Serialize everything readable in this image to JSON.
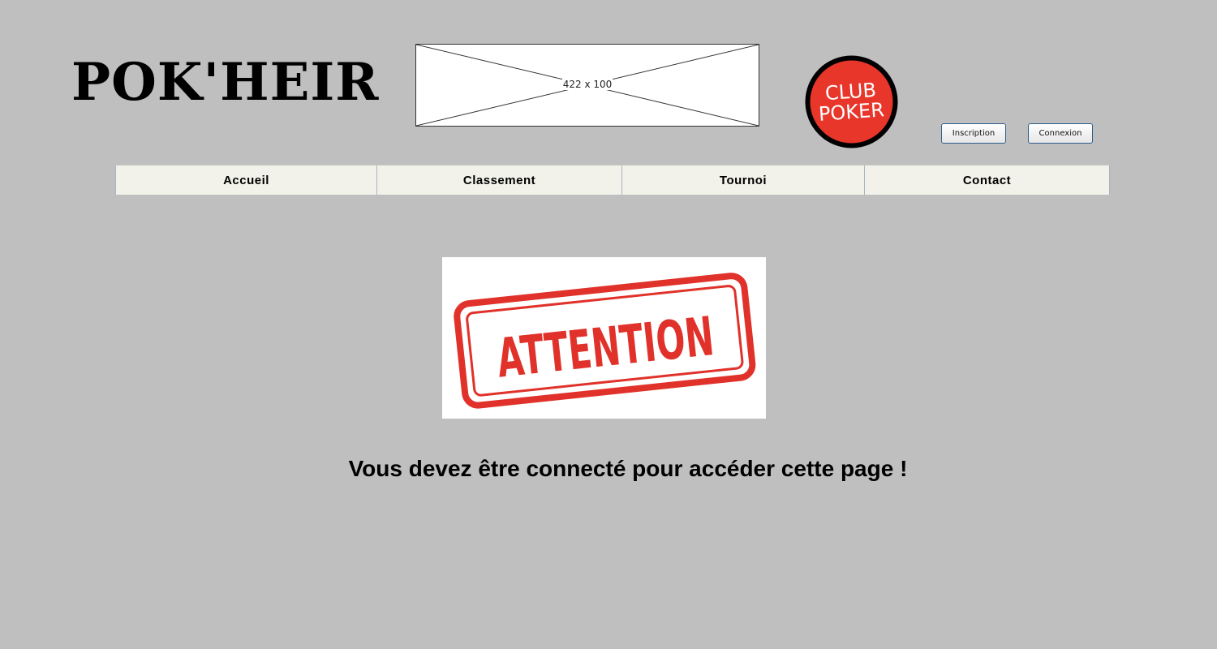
{
  "header": {
    "site_title": "POK'HEIR",
    "banner_placeholder": "422 x 100",
    "club_logo": {
      "line1": "CLUB",
      "line2": "POKER",
      "color": "#e8362a"
    },
    "buttons": {
      "inscription": "Inscription",
      "connexion": "Connexion"
    }
  },
  "nav": {
    "items": [
      {
        "label": "Accueil"
      },
      {
        "label": "Classement"
      },
      {
        "label": "Tournoi"
      },
      {
        "label": "Contact"
      }
    ]
  },
  "main": {
    "stamp_text": "ATTENTION",
    "stamp_color": "#e0322a",
    "message": "Vous devez être connecté pour accéder cette page !"
  }
}
